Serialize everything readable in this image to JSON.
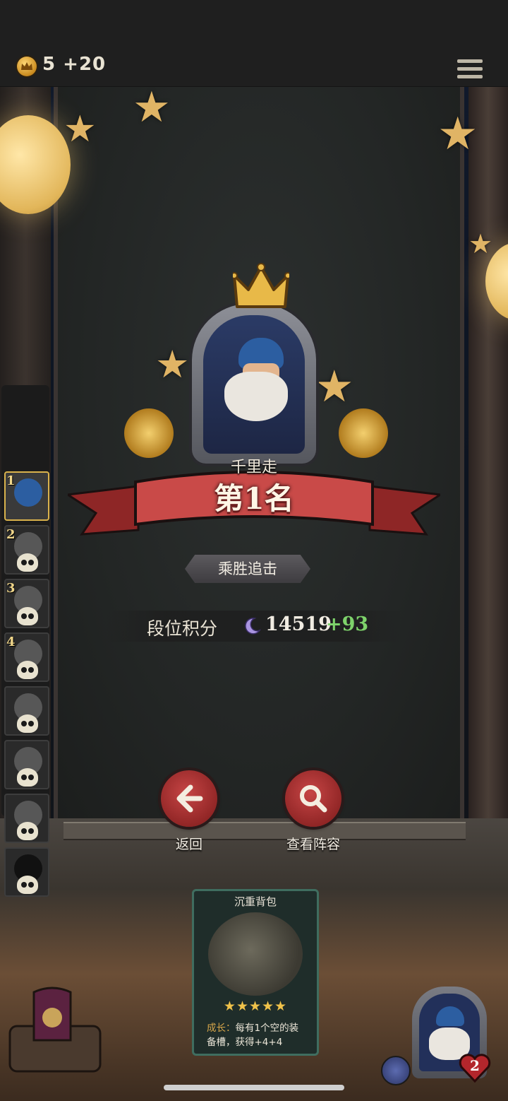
{
  "topbar": {
    "coin_icon": "crown-coin-icon",
    "coins": "5",
    "coins_bonus": "+20",
    "menu_icon": "menu-icon"
  },
  "rank_list": [
    {
      "num": "1",
      "selected": true
    },
    {
      "num": "2",
      "selected": false
    },
    {
      "num": "3",
      "selected": false
    },
    {
      "num": "4",
      "selected": false
    },
    {
      "num": "",
      "selected": false
    },
    {
      "num": "",
      "selected": false
    },
    {
      "num": "",
      "selected": false
    },
    {
      "num": "",
      "selected": false
    }
  ],
  "result": {
    "player_name": "千里走",
    "rank_text": "第1名",
    "streak_badge": "乘胜追击",
    "score_label": "段位积分",
    "score_value": "14519",
    "score_delta": "+93"
  },
  "actions": {
    "back_label": "返回",
    "view_lineup_label": "查看阵容"
  },
  "item_card": {
    "title": "沉重背包",
    "stars": "★★★★★",
    "desc_prefix": "成长：",
    "desc_body": "每有1个空的装备槽，获得+4+4"
  },
  "player_hud": {
    "lives": "2"
  },
  "colors": {
    "accent_red": "#b83434",
    "gold": "#d9b24c",
    "positive_green": "#7ed36b"
  }
}
